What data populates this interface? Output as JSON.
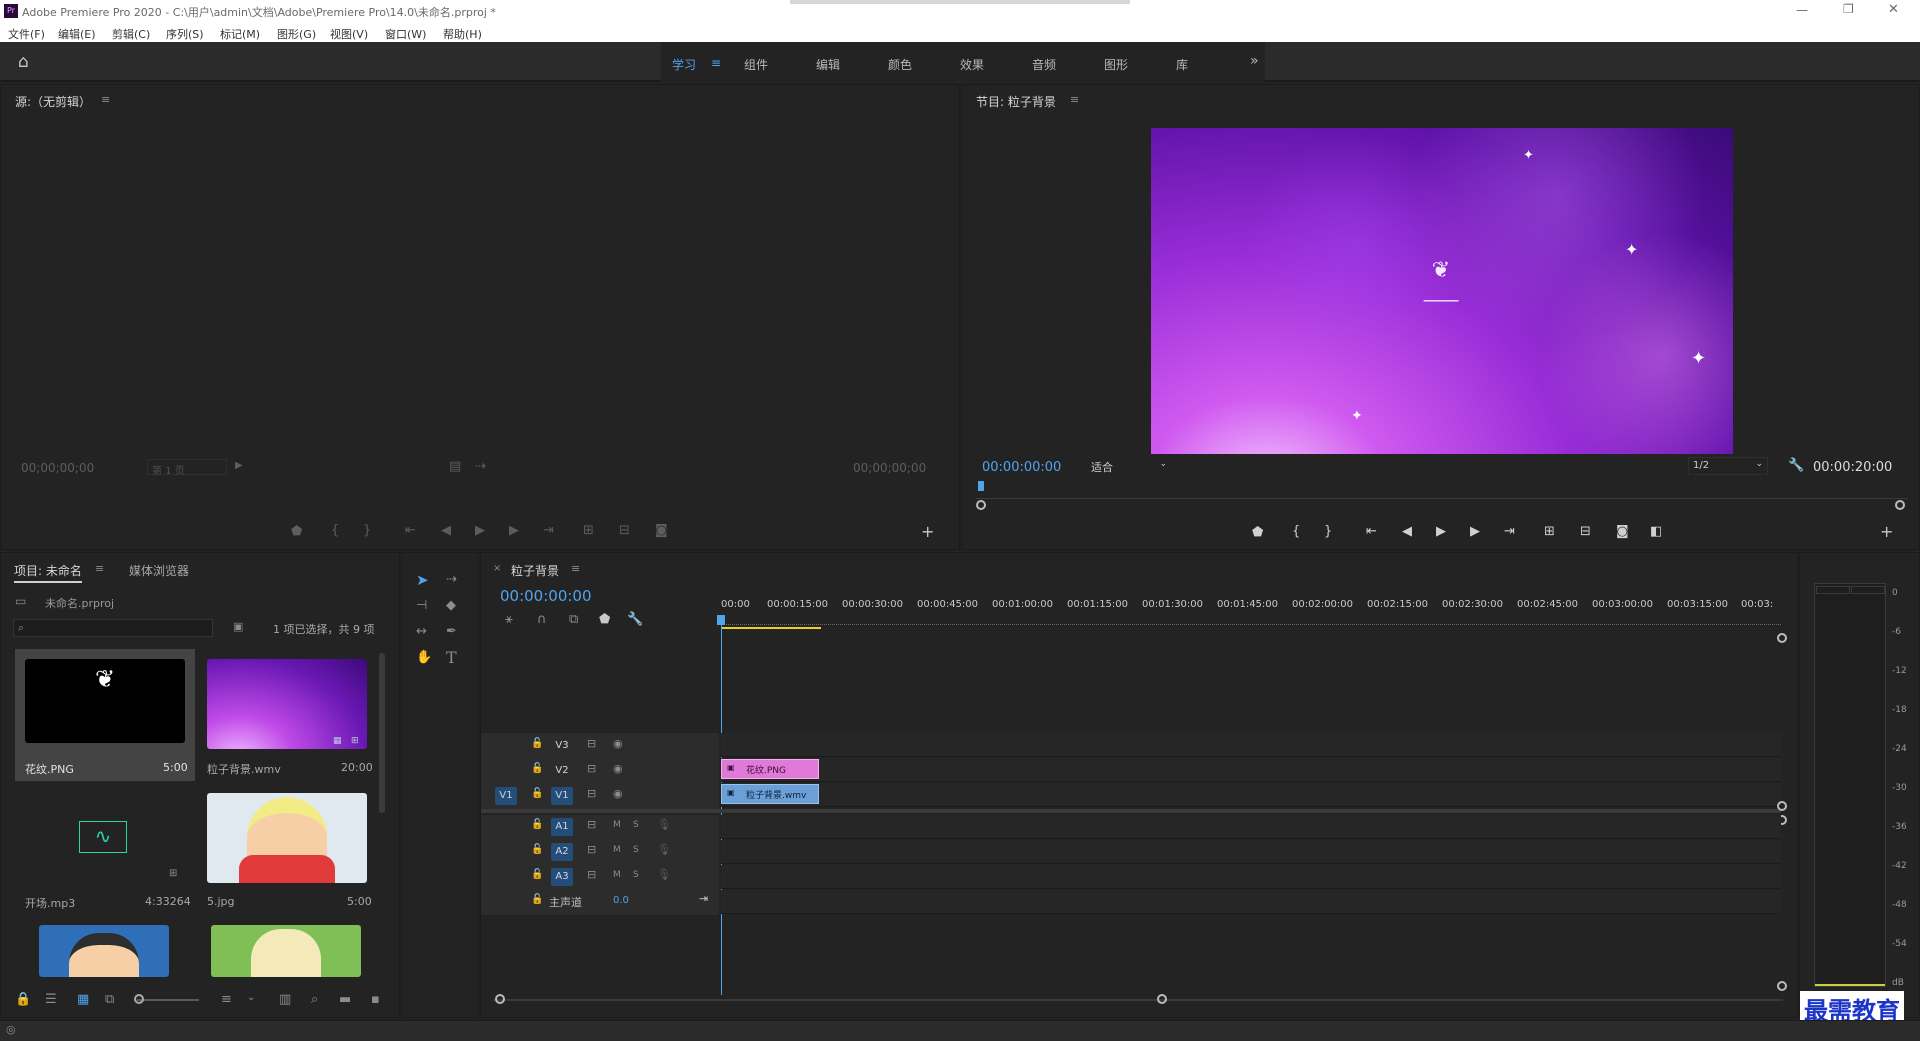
{
  "window": {
    "title": "Adobe Premiere Pro 2020 - C:\\用户\\admin\\文档\\Adobe\\Premiere Pro\\14.0\\未命名.prproj *",
    "app_icon": "Pr"
  },
  "menu": [
    "文件(F)",
    "编辑(E)",
    "剪辑(C)",
    "序列(S)",
    "标记(M)",
    "图形(G)",
    "视图(V)",
    "窗口(W)",
    "帮助(H)"
  ],
  "workspaces": {
    "active": "学习",
    "tabs": [
      "学习",
      "组件",
      "编辑",
      "颜色",
      "效果",
      "音频",
      "图形",
      "库"
    ]
  },
  "source": {
    "title": "源:（无剪辑）",
    "timecode_left": "00;00;00;00",
    "page": "第 1 页",
    "timecode_right": "00;00;00;00"
  },
  "program": {
    "title": "节目: 粒子背景",
    "timecode": "00:00:00:00",
    "fit": "适合",
    "quality": "1/2",
    "duration": "00:00:20:00"
  },
  "project": {
    "tabs": [
      "项目: 未命名",
      "媒体浏览器"
    ],
    "file": "未命名.prproj",
    "selection": "1 项已选择，共 9 项",
    "items": [
      {
        "name": "花纹.PNG",
        "duration": "5:00"
      },
      {
        "name": "粒子背景.wmv",
        "duration": "20:00"
      },
      {
        "name": "开场.mp3",
        "duration": "4:33264"
      },
      {
        "name": "5.jpg",
        "duration": "5:00"
      }
    ]
  },
  "timeline": {
    "title": "粒子背景",
    "timecode": "00:00:00:00",
    "ruler": [
      "00:00",
      "00:00:15:00",
      "00:00:30:00",
      "00:00:45:00",
      "00:01:00:00",
      "00:01:15:00",
      "00:01:30:00",
      "00:01:45:00",
      "00:02:00:00",
      "00:02:15:00",
      "00:02:30:00",
      "00:02:45:00",
      "00:03:00:00",
      "00:03:15:00",
      "00:03:"
    ],
    "video_tracks": [
      "V3",
      "V2",
      "V1"
    ],
    "audio_tracks": [
      "A1",
      "A2",
      "A3"
    ],
    "source_patch": "V1",
    "master_label": "主声道",
    "master_value": "0.0",
    "clips": [
      {
        "name": "花纹.PNG",
        "track": "V2"
      },
      {
        "name": "粒子背景.wmv",
        "track": "V1"
      }
    ]
  },
  "audio_meter": {
    "scale": [
      "0",
      "-6",
      "-12",
      "-18",
      "-24",
      "-30",
      "-36",
      "-42",
      "-48",
      "-54",
      "dB"
    ]
  },
  "watermark": "最需教育",
  "colors": {
    "accent": "#4fa4ec",
    "panel": "#232323",
    "clip_png": "#e179d8",
    "clip_wmv": "#6a9fd8"
  }
}
